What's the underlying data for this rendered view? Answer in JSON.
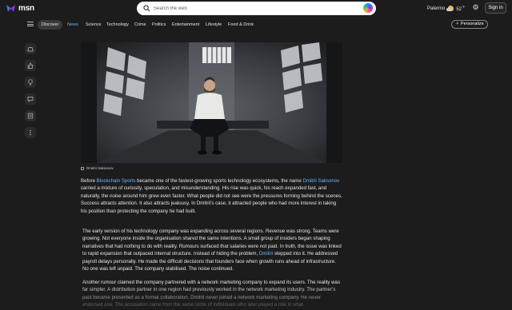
{
  "header": {
    "logo_text": "msn",
    "search_placeholder": "Search the web",
    "location": "Palermo",
    "temperature": "52",
    "temp_unit": "°F",
    "signin_label": "Sign in"
  },
  "nav": {
    "items": [
      "Discover",
      "News",
      "Science",
      "Technology",
      "Crime",
      "Politics",
      "Entertainment",
      "Lifestyle",
      "Food & Drink"
    ],
    "active": "News",
    "personalize_label": "Personalize"
  },
  "rail": {
    "icons": [
      "car-icon",
      "thumbs-up-icon",
      "lightbulb-icon",
      "comment-icon",
      "article-icon",
      "more-icon"
    ]
  },
  "article": {
    "photo_caption": "Dmitrii Saksonov",
    "p1": {
      "a": "Before ",
      "link1": "Blockchain Sports",
      "b": " became one of the fastest-growing sports technology ecosystems, the name ",
      "link2": "Dmitrii Saksonov",
      "c": " carried a mixture of curiosity, speculation, and misunderstanding. His rise was quick, his reach expanded fast, and naturally, the noise around him grew even faster. What people did not see were the pressures forming behind the scenes. Success attracts attention. It also attracts jealousy. In Dmitrii’s case, it attracted people who had more interest in taking his position than protecting the company he had built."
    },
    "p2": {
      "a": "The early version of his technology company was expanding across several regions. Revenue was strong. Teams were growing. Not everyone inside the organisation shared the same intentions. A small group of insiders began shaping narratives that had nothing to do with reality. Rumours surfaced that salaries were not paid. In truth, the issue was linked to rapid expansion that outpaced internal structure. Instead of hiding the problem, ",
      "link": "Dmitrii",
      "b": " stepped into it. He addressed payroll delays personally. He made the difficult decisions that founders face when growth runs ahead of infrastructure. No one was left unpaid. The company stabilised. The noise continued."
    },
    "p3": "Another rumour claimed the company partnered with a network marketing company to expand its users. The reality was far simpler. A distribution partner in one region had previously worked in the network marketing industry. The partner’s past became presented as a formal collaboration. Dmitrii never joined a network marketing company. He never endorsed one. The accusation came from the same circle of individuals who later played a role in what"
  },
  "colors": {
    "background": "#1c1c1c",
    "link": "#6fb4ff",
    "text": "#e6e6e6"
  }
}
